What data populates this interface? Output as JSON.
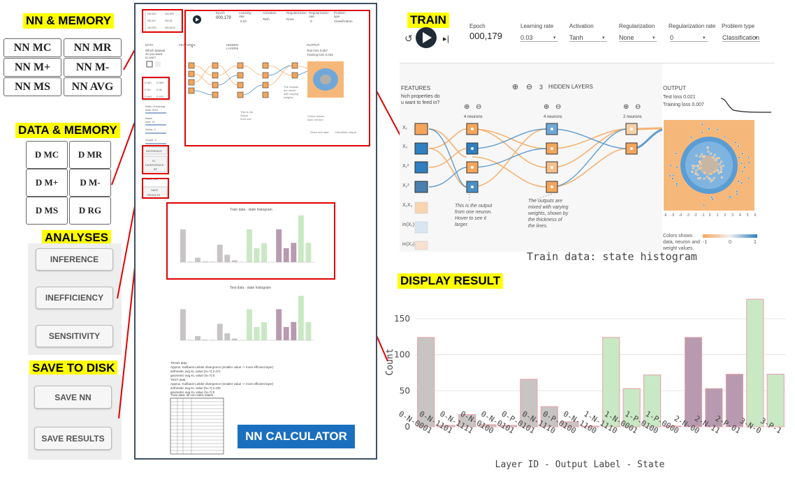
{
  "labels": {
    "nn_memory": "NN & MEMORY",
    "data_memory": "DATA & MEMORY",
    "analyses": "ANALYSES",
    "save_to_disk": "SAVE TO DISK",
    "train": "TRAIN",
    "display_result": "DISPLAY RESULT",
    "nn_calculator": "NN CALCULATOR"
  },
  "nn_keys": [
    "NN MC",
    "NN MR",
    "NN M+",
    "NN M-",
    "NN MS",
    "NN AVG"
  ],
  "data_keys": [
    "D MC",
    "D MR",
    "D M+",
    "D M-",
    "D MS",
    "D RG"
  ],
  "analysis_buttons": [
    "INFERENCE",
    "INEFFICIENCY",
    "SENSITIVITY"
  ],
  "save_buttons": [
    "SAVE NN",
    "SAVE RESULTS"
  ],
  "calc_mini": {
    "nn_keys": [
      "NN MC",
      "NN MR",
      "NN M+",
      "NN M-",
      "NN MS",
      "NN AVG"
    ],
    "data_keys": [
      "D MC",
      "D MR",
      "D M+",
      "D M-",
      "D MS",
      "D RG"
    ],
    "inference": "INFERENCE",
    "kl_divergence": "KL DIVERGENCE",
    "save_nn": "SAVE NN",
    "save_results": "SAVE RESULTS",
    "hist1_title": "Train data : state histogram",
    "hist2_title": "Test data : state histogram",
    "text_lines": [
      "TRAIN data",
      "Approx. Kullback-Leibler divergence (smaller value -> more efficient layer)",
      "arithmetic avg KL value (N=?):2.471",
      "geometric avg KL value (N=?):0",
      "TEST data",
      "Approx. Kullback-Leibler divergence (smaller value -> more efficient layer)",
      "arithmetic avg KL value (N=?):2.425",
      "geometric avg KL value (N=?):0"
    ],
    "table_title": "Train data: all non-static states"
  },
  "playground": {
    "epoch_label": "Epoch",
    "epoch_value": "000,179",
    "learning_rate_label": "Learning rate",
    "learning_rate_value": "0.03",
    "activation_label": "Activation",
    "activation_value": "Tanh",
    "regularization_label": "Regularization",
    "regularization_value": "None",
    "reg_rate_label": "Regularization rate",
    "reg_rate_value": "0",
    "problem_type_label": "Problem type",
    "problem_type_value": "Classification",
    "features_title": "FEATURES",
    "features_sub1": "hich properties do",
    "features_sub2": "u want to feed in?",
    "hidden_layers_count": "3",
    "hidden_layers_label": "HIDDEN LAYERS",
    "layer_neurons": [
      "4 neurons",
      "4 neurons",
      "2 neurons"
    ],
    "output_title": "OUTPUT",
    "test_loss": "Test loss 0.021",
    "training_loss": "Training loss 0.007",
    "feature_labels": [
      "X₁",
      "X₂",
      "X₁²",
      "X₂²",
      "X₁X₂",
      "in(X₁)",
      "in(X₂)"
    ],
    "note1_l1": "This is the output",
    "note1_l2": "from one neuron.",
    "note1_l3": "Hover to see it",
    "note1_l4": "larger.",
    "note2_l1": "The outputs are",
    "note2_l2": "mixed with varying",
    "note2_l3": "weights, shown by",
    "note2_l4": "the thickness of",
    "note2_l5": "the lines.",
    "colors_l1": "Colors shows",
    "colors_l2": "data, neuron and",
    "colors_l3": "weight values.",
    "scale_min": "-1",
    "scale_mid": "0",
    "scale_max": "1",
    "axis_ticks": [
      "-6",
      "-5",
      "-4",
      "-3",
      "-2",
      "-1",
      "0",
      "1",
      "2",
      "3",
      "4",
      "5",
      "6"
    ]
  },
  "colors": {
    "orange": "#f5a65b",
    "blue": "#2f7fc1",
    "purple": "#b89ab0",
    "green": "#c9e8c4",
    "gray": "#c8c4c4",
    "red": "#e00000",
    "yellow": "#ffff00"
  },
  "chart_data": {
    "type": "bar",
    "title": "Train data: state histogram",
    "xlabel": "Layer ID - Output Label - State",
    "ylabel": "Count",
    "ylim": [
      0,
      180
    ],
    "yticks": [
      0,
      50,
      100,
      150
    ],
    "categories": [
      "0-N-0001",
      "0-N-1101",
      "0-N-1111",
      "0-N-0100",
      "0-N-0101",
      "0-P-0101",
      "0-N-1110",
      "0-P-0100",
      "0-N-1100",
      "1-N-1110",
      "1-N-0001",
      "1-P-0100",
      "1-P-0000",
      "2-N-00",
      "2-N-11",
      "2-P-01",
      "3-N-0",
      "3-P-1"
    ],
    "category_labels": [
      "0-N-0001",
      "0-N-1101",
      "0-N-1111",
      "0-N-0100",
      "0-N-0101",
      "0-P-0101",
      "0-N-1110",
      "0-P-0100",
      "0-N-1100",
      "1-N-1110",
      "1-N-0001",
      "1-P-0100",
      "1-P-0000",
      "2-N-00",
      "2-N-11",
      "2-P-01",
      "3-N-0",
      "3-P-1"
    ],
    "visible_tick_labels": [
      "0-N-0001",
      "0-N-1101",
      "0-N-1111",
      "0-N-0100",
      "0-N-0101",
      "0-P-0101",
      "0-N-1110",
      "0-P-0100",
      "0-N-1100",
      "1-N-1110",
      "1-N-0001",
      "1-P-0100",
      "1-P-0000",
      "2-N-00",
      "2-N-11",
      "2-P-01",
      "3-N-0",
      "3-P-1"
    ],
    "values": [
      124,
      2,
      17,
      3,
      2,
      66,
      28,
      7,
      1,
      124,
      53,
      72,
      1,
      124,
      53,
      73,
      177,
      73
    ],
    "bar_colors": [
      "gray",
      "gray",
      "gray",
      "gray",
      "gray",
      "gray",
      "gray",
      "gray",
      "gray",
      "green",
      "green",
      "green",
      "green",
      "purple",
      "purple",
      "purple",
      "green",
      "green"
    ]
  }
}
